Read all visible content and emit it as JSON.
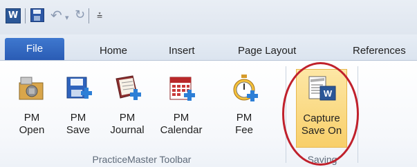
{
  "qat": {
    "app_icon": "W",
    "customize_icon": "customize-qat-icon"
  },
  "tabs": [
    {
      "label": "File"
    },
    {
      "label": "Home"
    },
    {
      "label": "Insert"
    },
    {
      "label": "Page Layout"
    },
    {
      "label": "References"
    }
  ],
  "groups": [
    {
      "label": "PracticeMaster Toolbar",
      "buttons": [
        {
          "line1": "PM",
          "line2": "Open",
          "icon": "folder-open-icon"
        },
        {
          "line1": "PM",
          "line2": "Save",
          "icon": "save-plus-icon"
        },
        {
          "line1": "PM",
          "line2": "Journal",
          "icon": "journal-icon"
        },
        {
          "line1": "PM",
          "line2": "Calendar",
          "icon": "calendar-icon"
        },
        {
          "line1": "PM",
          "line2": "Fee",
          "icon": "stopwatch-icon"
        }
      ]
    },
    {
      "label": "Saving",
      "buttons": [
        {
          "line1": "Capture",
          "line2": "Save On",
          "icon": "capture-document-icon"
        }
      ]
    }
  ],
  "colors": {
    "file_tab": "#2f63bd",
    "highlight": "#f8cf6a",
    "callout": "#c0212c"
  }
}
